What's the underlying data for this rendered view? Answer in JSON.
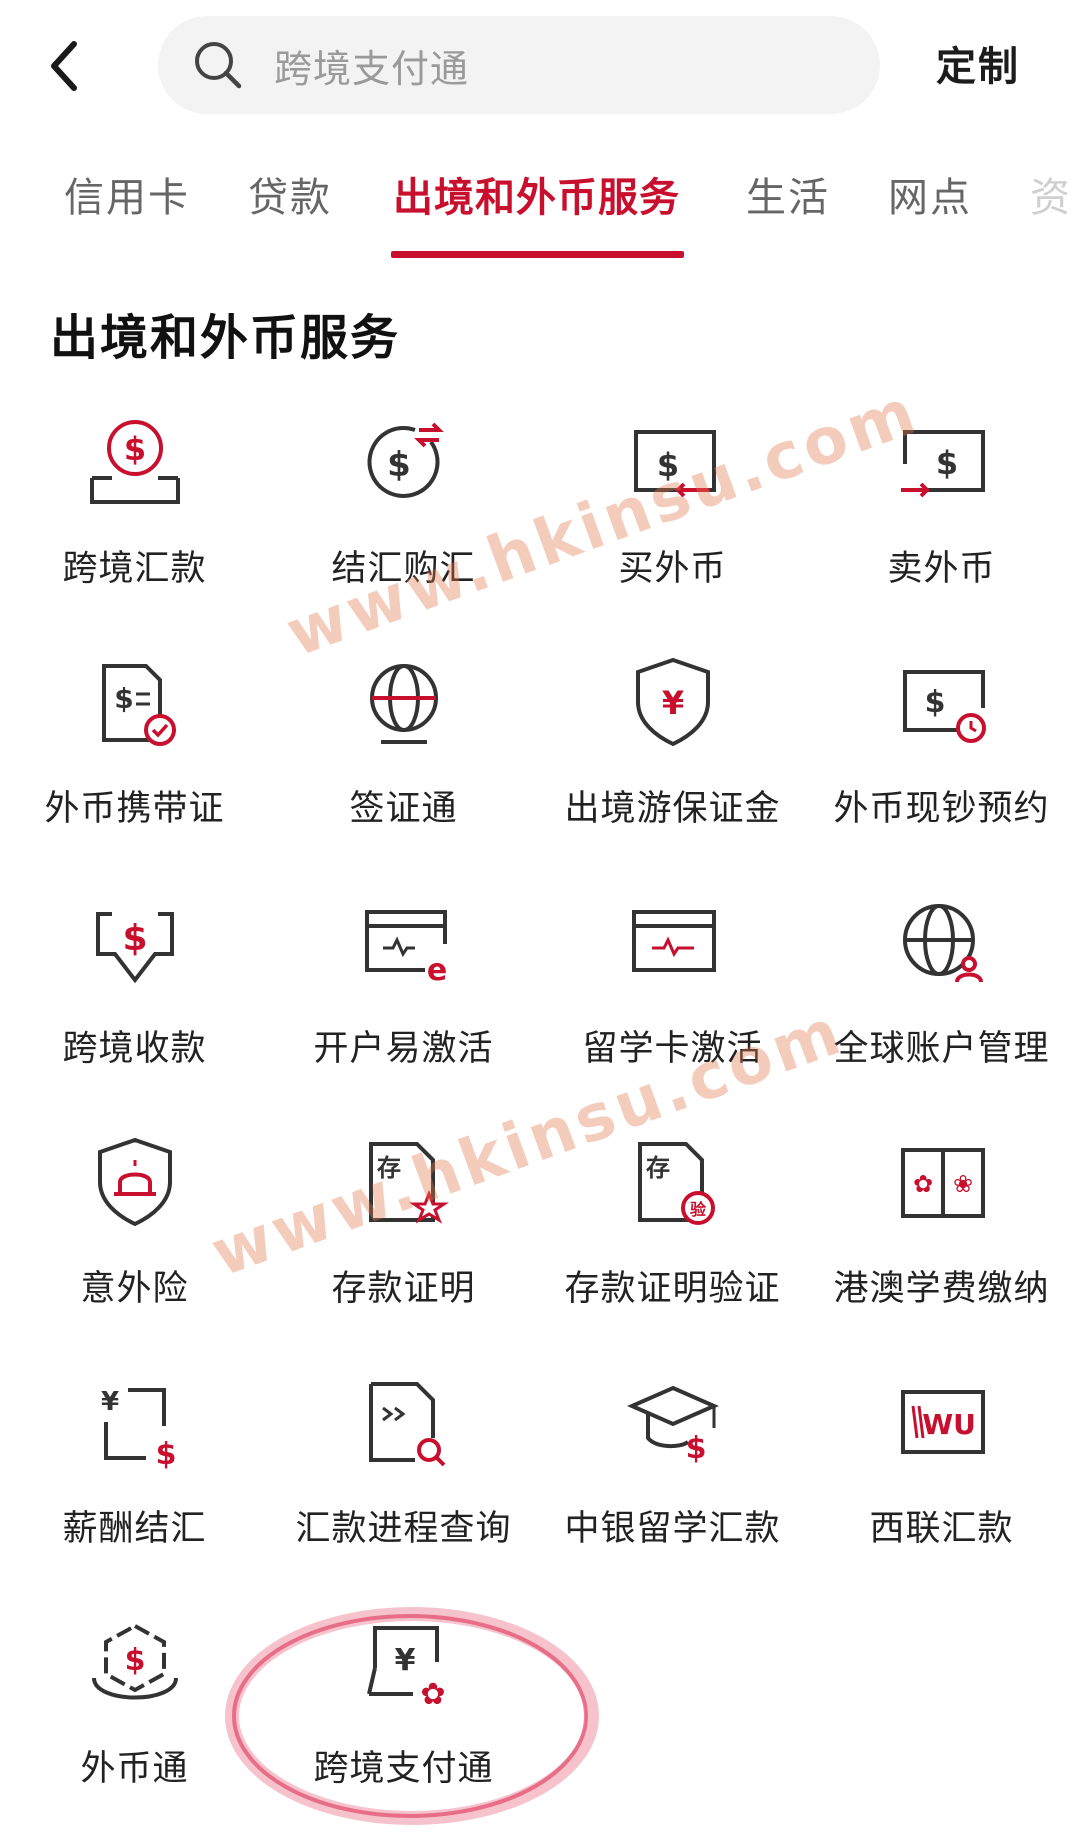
{
  "header": {
    "search_placeholder": "跨境支付通",
    "customize_label": "定制"
  },
  "tabs": [
    {
      "label": "信用卡"
    },
    {
      "label": "贷款"
    },
    {
      "label": "出境和外币服务"
    },
    {
      "label": "生活"
    },
    {
      "label": "网点"
    },
    {
      "label": "资"
    }
  ],
  "section": {
    "title": "出境和外币服务"
  },
  "items": [
    {
      "label": "跨境汇款",
      "icon": "dollar-tray-icon"
    },
    {
      "label": "结汇购汇",
      "icon": "dollar-exchange-icon"
    },
    {
      "label": "买外币",
      "icon": "buy-currency-icon"
    },
    {
      "label": "卖外币",
      "icon": "sell-currency-icon"
    },
    {
      "label": "外币携带证",
      "icon": "document-check-icon"
    },
    {
      "label": "签证通",
      "icon": "globe-icon"
    },
    {
      "label": "出境游保证金",
      "icon": "yuan-shield-icon"
    },
    {
      "label": "外币现钞预约",
      "icon": "cash-clock-icon"
    },
    {
      "label": "跨境收款",
      "icon": "dollar-down-icon"
    },
    {
      "label": "开户易激活",
      "icon": "card-e-icon"
    },
    {
      "label": "留学卡激活",
      "icon": "card-activate-icon"
    },
    {
      "label": "全球账户管理",
      "icon": "globe-user-icon"
    },
    {
      "label": "意外险",
      "icon": "alarm-shield-icon"
    },
    {
      "label": "存款证明",
      "icon": "deposit-star-icon"
    },
    {
      "label": "存款证明验证",
      "icon": "deposit-verify-icon"
    },
    {
      "label": "港澳学费缴纳",
      "icon": "hk-macau-book-icon"
    },
    {
      "label": "薪酬结汇",
      "icon": "salary-exchange-icon"
    },
    {
      "label": "汇款进程查询",
      "icon": "remit-query-icon"
    },
    {
      "label": "中银留学汇款",
      "icon": "graduation-cap-icon"
    },
    {
      "label": "西联汇款",
      "icon": "western-union-icon"
    },
    {
      "label": "外币通",
      "icon": "dollar-hexagon-icon"
    },
    {
      "label": "跨境支付通",
      "icon": "yuan-bauhinia-icon"
    }
  ],
  "watermark": {
    "text": "www.hkinsu.com",
    "brand_color": "#c8102e"
  }
}
